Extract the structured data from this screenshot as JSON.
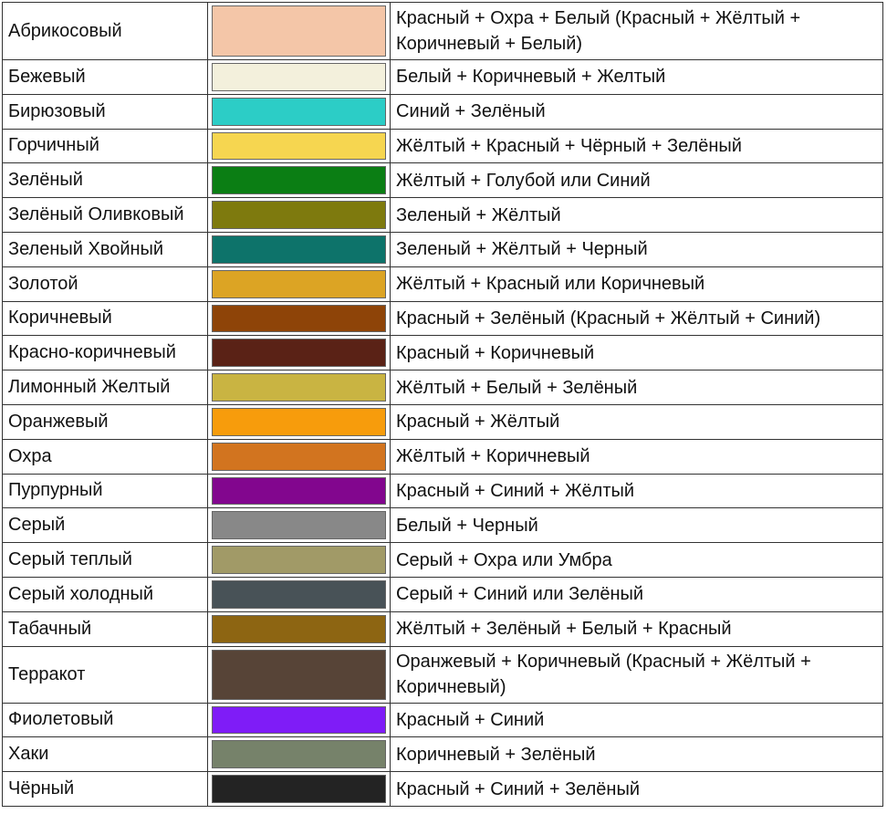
{
  "rows": [
    {
      "name": "Абрикосовый",
      "color": "#F4C6A8",
      "mix": "Красный + Охра + Белый (Красный + Жёлтый + Коричневый + Белый)"
    },
    {
      "name": "Бежевый",
      "color": "#F3F0DC",
      "mix": "Белый + Коричневый + Желтый"
    },
    {
      "name": "Бирюзовый",
      "color": "#2CCDC6",
      "mix": "Синий + Зелёный"
    },
    {
      "name": "Горчичный",
      "color": "#F6D650",
      "mix": "Жёлтый + Красный + Чёрный + Зелёный"
    },
    {
      "name": "Зелёный",
      "color": "#0B7E14",
      "mix": "Жёлтый + Голубой или Синий"
    },
    {
      "name": "Зелёный Оливковый",
      "color": "#7E7A0E",
      "mix": "Зеленый + Жёлтый"
    },
    {
      "name": "Зеленый Хвойный",
      "color": "#0D736A",
      "mix": "Зеленый + Жёлтый + Черный"
    },
    {
      "name": "Золотой",
      "color": "#DCA424",
      "mix": "Жёлтый + Красный или Коричневый"
    },
    {
      "name": "Коричневый",
      "color": "#8E4408",
      "mix": "Красный + Зелёный (Красный + Жёлтый + Синий)"
    },
    {
      "name": "Красно-коричневый",
      "color": "#5A2216",
      "mix": "Красный + Коричневый"
    },
    {
      "name": "Лимонный Желтый",
      "color": "#C9B442",
      "mix": "Жёлтый + Белый + Зелёный"
    },
    {
      "name": "Оранжевый",
      "color": "#F79C0C",
      "mix": "Красный + Жёлтый"
    },
    {
      "name": "Охра",
      "color": "#D2741F",
      "mix": "Жёлтый + Коричневый"
    },
    {
      "name": "Пурпурный",
      "color": "#82068E",
      "mix": "Красный + Синий + Жёлтый"
    },
    {
      "name": "Серый",
      "color": "#888888",
      "mix": "Белый + Черный"
    },
    {
      "name": "Серый теплый",
      "color": "#A19A67",
      "mix": "Серый + Охра или Умбра"
    },
    {
      "name": "Серый холодный",
      "color": "#485257",
      "mix": "Серый + Синий или Зелёный"
    },
    {
      "name": "Табачный",
      "color": "#8D6512",
      "mix": "Жёлтый + Зелёный + Белый + Красный"
    },
    {
      "name": "Терракот",
      "color": "#574437",
      "mix": "Оранжевый + Коричневый (Красный + Жёлтый + Коричневый)"
    },
    {
      "name": "Фиолетовый",
      "color": "#7F1CF7",
      "mix": "Красный + Синий"
    },
    {
      "name": "Хаки",
      "color": "#76826A",
      "mix": "Коричневый + Зелёный"
    },
    {
      "name": "Чёрный",
      "color": "#232323",
      "mix": "Красный + Синий + Зелёный"
    }
  ]
}
